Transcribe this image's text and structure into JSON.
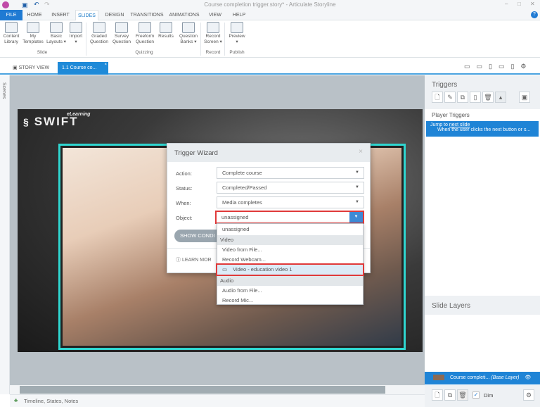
{
  "window": {
    "title": "Course completion trigger.story* - Articulate Storyline"
  },
  "ribbon_tabs": [
    "FILE",
    "HOME",
    "INSERT",
    "SLIDES",
    "DESIGN",
    "TRANSITIONS",
    "ANIMATIONS",
    "VIEW",
    "HELP"
  ],
  "ribbon": {
    "buttons": [
      {
        "l1": "Content",
        "l2": "Library"
      },
      {
        "l1": "My",
        "l2": "Templates"
      },
      {
        "l1": "Basic",
        "l2": "Layouts ▾"
      },
      {
        "l1": "Import",
        "l2": "▾"
      },
      {
        "l1": "Graded",
        "l2": "Question"
      },
      {
        "l1": "Survey",
        "l2": "Question"
      },
      {
        "l1": "Freeform",
        "l2": "Question"
      },
      {
        "l1": "Results",
        "l2": ""
      },
      {
        "l1": "Question",
        "l2": "Banks ▾"
      },
      {
        "l1": "Record",
        "l2": "Screen ▾"
      },
      {
        "l1": "Preview",
        "l2": "▾"
      }
    ],
    "groups": [
      "Slide",
      "Quizzing",
      "Record",
      "Publish"
    ]
  },
  "view_tabs": {
    "story": "STORY VIEW",
    "slide": "1.1 Course co..."
  },
  "scenes_label": "Scenes",
  "bottom_bar": "Timeline, States, Notes",
  "triggers": {
    "title": "Triggers",
    "section": "Player Triggers",
    "item_action": "Jump to",
    "item_target": "next slide",
    "item_condition": "When the user clicks the next button or s..."
  },
  "layers": {
    "title": "Slide Layers",
    "base_name": "Course completi...",
    "base_label": "(Base Layer)",
    "dim": "Dim"
  },
  "dialog": {
    "title": "Trigger Wizard",
    "fields": [
      {
        "label": "Action:",
        "value": "Complete course"
      },
      {
        "label": "Status:",
        "value": "Completed/Passed"
      },
      {
        "label": "When:",
        "value": "Media completes"
      },
      {
        "label": "Object:",
        "value": "unassigned"
      }
    ],
    "show_conditions": "SHOW CONDI",
    "learn_more": "LEARN MOR"
  },
  "dropdown": {
    "items": [
      {
        "type": "item",
        "label": "unassigned"
      },
      {
        "type": "header",
        "label": "Video"
      },
      {
        "type": "item",
        "label": "Video from File..."
      },
      {
        "type": "item",
        "label": "Record Webcam..."
      },
      {
        "type": "selected",
        "label": "Video - education video 1"
      },
      {
        "type": "header",
        "label": "Audio"
      },
      {
        "type": "item",
        "label": "Audio from File..."
      },
      {
        "type": "item",
        "label": "Record Mic..."
      }
    ]
  },
  "logo": {
    "text": "SWIFT",
    "sub": "eLearning"
  },
  "colors": {
    "accent": "#1f7ad3",
    "highlight": "#e03a3a",
    "teal": "#2fd6d0"
  }
}
